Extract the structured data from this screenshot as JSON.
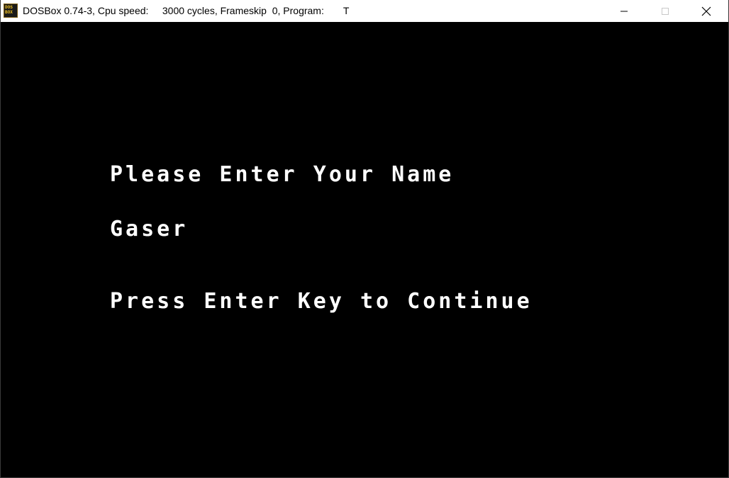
{
  "window": {
    "title": "DOSBox 0.74-3, Cpu speed:     3000 cycles, Frameskip  0, Program:       T",
    "icon": "dosbox-icon",
    "icon_text": "DOS BOX",
    "controls": {
      "minimize": "minimize-icon",
      "maximize": "maximize-icon",
      "close": "close-icon"
    }
  },
  "screen": {
    "prompt": "Please Enter Your Name",
    "name_value": "Gaser",
    "continue_hint": "Press Enter Key to Continue",
    "text_color": "#ffffff",
    "background_color": "#000000"
  }
}
